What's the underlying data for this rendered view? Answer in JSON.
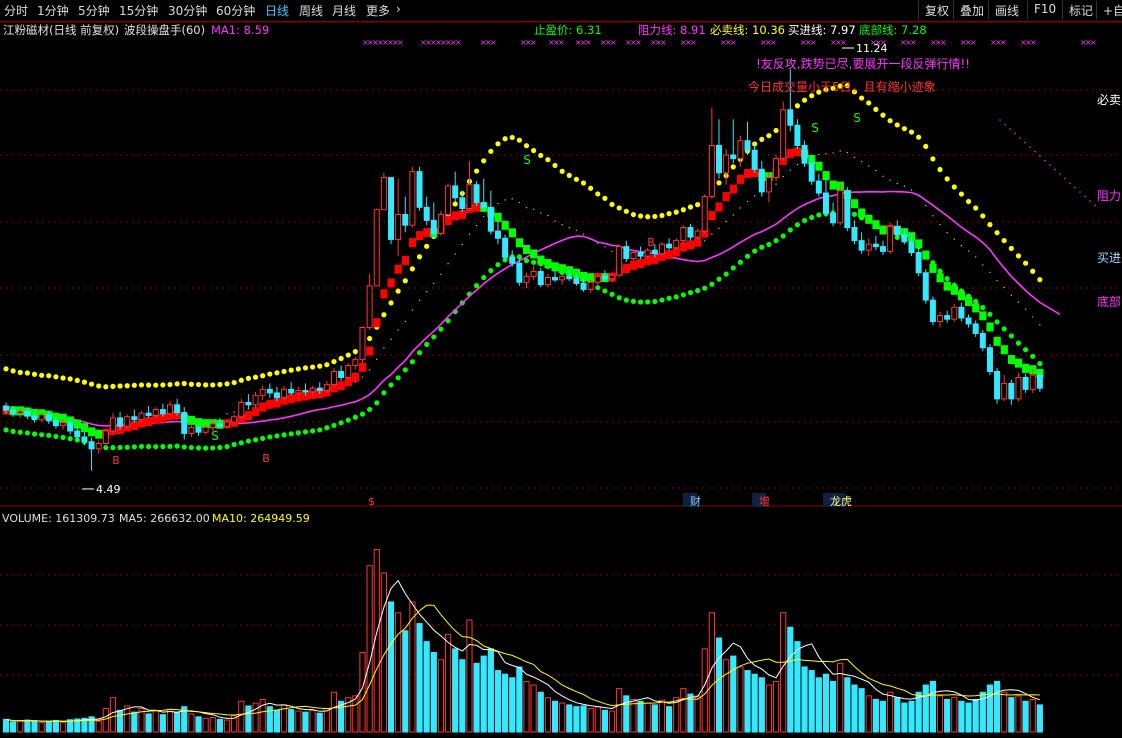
{
  "toolbar": {
    "periods": [
      "分时",
      "1分钟",
      "5分钟",
      "15分钟",
      "30分钟",
      "60分钟",
      "日线",
      "周线",
      "月线",
      "更多"
    ],
    "active_period": "日线",
    "buttons": [
      "复权",
      "叠加",
      "画线",
      "F10",
      "标记",
      "+自选"
    ]
  },
  "main_header": {
    "title": "江粉磁材(日线 前复权)",
    "indicator": "波段操盘手(60)",
    "ma1_label": "MA1: 8.59",
    "stop_profit": "止盈价: 6.31",
    "resist": "阻力线: 8.91",
    "must_sell": "必卖线: 10.36",
    "buy_line": "买进线: 7.97",
    "bottom_line": "底部线: 7.28"
  },
  "annotations": {
    "msg1": "!友反攻,跌势已尽,要展开一段反弹行情!!",
    "msg2": "今日成交量小于5日，且有缩小迹象",
    "high_label": "11.24",
    "low_label": "4.49",
    "right_labels": [
      "必卖",
      "阻力",
      "买进",
      "底部"
    ],
    "event_labels": [
      "$",
      "财",
      "增",
      "龙虎"
    ],
    "buy_mark": "B",
    "sell_mark": "S"
  },
  "volume_header": {
    "volume": "VOLUME: 161309.73",
    "ma5": "MA5: 266632.00",
    "ma10": "MA10: 264949.59"
  },
  "colors": {
    "up": "#ff3333",
    "down": "#33e8ff",
    "red_band": "#ff0000",
    "green_band": "#00ff00",
    "yellow_dots": "#ffff00",
    "ma1": "#ff33ff",
    "ma5": "#ffffff",
    "ma10": "#ffff00",
    "grid": "#8b0000"
  },
  "chart_data": {
    "type": "candlestick",
    "ylim": [
      4.0,
      11.8
    ],
    "volume_ylim": [
      0,
      570000
    ],
    "candles": [
      {
        "o": 5.58,
        "h": 5.64,
        "l": 5.45,
        "c": 5.51,
        "v": 35000
      },
      {
        "o": 5.51,
        "h": 5.58,
        "l": 5.4,
        "c": 5.46,
        "v": 28000
      },
      {
        "o": 5.46,
        "h": 5.54,
        "l": 5.38,
        "c": 5.49,
        "v": 30000
      },
      {
        "o": 5.49,
        "h": 5.55,
        "l": 5.36,
        "c": 5.41,
        "v": 33000
      },
      {
        "o": 5.41,
        "h": 5.48,
        "l": 5.3,
        "c": 5.35,
        "v": 31000
      },
      {
        "o": 5.35,
        "h": 5.46,
        "l": 5.31,
        "c": 5.43,
        "v": 26000
      },
      {
        "o": 5.43,
        "h": 5.5,
        "l": 5.28,
        "c": 5.33,
        "v": 29000
      },
      {
        "o": 5.33,
        "h": 5.4,
        "l": 5.2,
        "c": 5.25,
        "v": 32000
      },
      {
        "o": 5.25,
        "h": 5.36,
        "l": 5.18,
        "c": 5.3,
        "v": 27000
      },
      {
        "o": 5.3,
        "h": 5.36,
        "l": 5.1,
        "c": 5.16,
        "v": 34000
      },
      {
        "o": 5.16,
        "h": 5.24,
        "l": 5.02,
        "c": 5.06,
        "v": 36000
      },
      {
        "o": 5.06,
        "h": 5.14,
        "l": 4.92,
        "c": 4.98,
        "v": 38000
      },
      {
        "o": 4.98,
        "h": 5.05,
        "l": 4.49,
        "c": 4.86,
        "v": 42000
      },
      {
        "o": 4.86,
        "h": 5.0,
        "l": 4.78,
        "c": 4.95,
        "v": 30000
      },
      {
        "o": 4.95,
        "h": 5.2,
        "l": 4.9,
        "c": 5.16,
        "v": 65000
      },
      {
        "o": 5.16,
        "h": 5.46,
        "l": 5.12,
        "c": 5.38,
        "v": 95000
      },
      {
        "o": 5.38,
        "h": 5.48,
        "l": 5.18,
        "c": 5.24,
        "v": 60000
      },
      {
        "o": 5.24,
        "h": 5.44,
        "l": 5.2,
        "c": 5.4,
        "v": 72000
      },
      {
        "o": 5.4,
        "h": 5.52,
        "l": 5.3,
        "c": 5.35,
        "v": 55000
      },
      {
        "o": 5.35,
        "h": 5.5,
        "l": 5.3,
        "c": 5.46,
        "v": 65000
      },
      {
        "o": 5.46,
        "h": 5.58,
        "l": 5.38,
        "c": 5.42,
        "v": 50000
      },
      {
        "o": 5.42,
        "h": 5.56,
        "l": 5.38,
        "c": 5.52,
        "v": 58000
      },
      {
        "o": 5.52,
        "h": 5.62,
        "l": 5.4,
        "c": 5.45,
        "v": 48000
      },
      {
        "o": 5.45,
        "h": 5.66,
        "l": 5.42,
        "c": 5.6,
        "v": 62000
      },
      {
        "o": 5.6,
        "h": 5.7,
        "l": 5.42,
        "c": 5.47,
        "v": 55000
      },
      {
        "o": 5.47,
        "h": 5.56,
        "l": 5.02,
        "c": 5.12,
        "v": 70000
      },
      {
        "o": 5.12,
        "h": 5.28,
        "l": 5.06,
        "c": 5.22,
        "v": 50000
      },
      {
        "o": 5.22,
        "h": 5.3,
        "l": 5.08,
        "c": 5.14,
        "v": 42000
      },
      {
        "o": 5.14,
        "h": 5.26,
        "l": 5.1,
        "c": 5.22,
        "v": 38000
      },
      {
        "o": 5.22,
        "h": 5.34,
        "l": 5.16,
        "c": 5.28,
        "v": 40000
      },
      {
        "o": 5.28,
        "h": 5.38,
        "l": 5.2,
        "c": 5.24,
        "v": 35000
      },
      {
        "o": 5.24,
        "h": 5.34,
        "l": 5.2,
        "c": 5.31,
        "v": 33000
      },
      {
        "o": 5.31,
        "h": 5.44,
        "l": 5.26,
        "c": 5.4,
        "v": 45000
      },
      {
        "o": 5.4,
        "h": 5.7,
        "l": 5.36,
        "c": 5.64,
        "v": 85000
      },
      {
        "o": 5.64,
        "h": 5.78,
        "l": 5.52,
        "c": 5.6,
        "v": 72000
      },
      {
        "o": 5.6,
        "h": 5.82,
        "l": 5.56,
        "c": 5.76,
        "v": 80000
      },
      {
        "o": 5.76,
        "h": 5.92,
        "l": 5.68,
        "c": 5.86,
        "v": 90000
      },
      {
        "o": 5.86,
        "h": 5.96,
        "l": 5.72,
        "c": 5.8,
        "v": 70000
      },
      {
        "o": 5.8,
        "h": 5.9,
        "l": 5.66,
        "c": 5.72,
        "v": 60000
      },
      {
        "o": 5.72,
        "h": 5.92,
        "l": 5.68,
        "c": 5.86,
        "v": 75000
      },
      {
        "o": 5.86,
        "h": 5.98,
        "l": 5.76,
        "c": 5.8,
        "v": 62000
      },
      {
        "o": 5.8,
        "h": 5.9,
        "l": 5.7,
        "c": 5.84,
        "v": 58000
      },
      {
        "o": 5.84,
        "h": 5.96,
        "l": 5.76,
        "c": 5.82,
        "v": 55000
      },
      {
        "o": 5.82,
        "h": 5.92,
        "l": 5.74,
        "c": 5.88,
        "v": 60000
      },
      {
        "o": 5.88,
        "h": 5.98,
        "l": 5.78,
        "c": 5.84,
        "v": 52000
      },
      {
        "o": 5.84,
        "h": 6.0,
        "l": 5.8,
        "c": 5.94,
        "v": 65000
      },
      {
        "o": 5.94,
        "h": 6.22,
        "l": 5.9,
        "c": 6.16,
        "v": 110000
      },
      {
        "o": 6.16,
        "h": 6.26,
        "l": 6.0,
        "c": 6.06,
        "v": 85000
      },
      {
        "o": 6.06,
        "h": 6.3,
        "l": 6.02,
        "c": 6.26,
        "v": 95000
      },
      {
        "o": 6.26,
        "h": 6.4,
        "l": 6.2,
        "c": 6.36,
        "v": 100000
      },
      {
        "o": 6.36,
        "h": 6.92,
        "l": 6.3,
        "c": 6.9,
        "v": 220000
      },
      {
        "o": 6.9,
        "h": 7.8,
        "l": 6.86,
        "c": 7.6,
        "v": 460000
      },
      {
        "o": 7.6,
        "h": 8.9,
        "l": 7.6,
        "c": 8.88,
        "v": 505000
      },
      {
        "o": 8.88,
        "h": 9.5,
        "l": 8.9,
        "c": 9.42,
        "v": 440000
      },
      {
        "o": 9.42,
        "h": 9.42,
        "l": 8.3,
        "c": 8.38,
        "v": 360000
      },
      {
        "o": 8.38,
        "h": 9.4,
        "l": 8.1,
        "c": 8.8,
        "v": 330000
      },
      {
        "o": 8.8,
        "h": 9.1,
        "l": 8.5,
        "c": 8.62,
        "v": 280000
      },
      {
        "o": 8.62,
        "h": 9.6,
        "l": 8.58,
        "c": 9.52,
        "v": 360000
      },
      {
        "o": 9.52,
        "h": 9.6,
        "l": 8.86,
        "c": 8.92,
        "v": 300000
      },
      {
        "o": 8.92,
        "h": 9.1,
        "l": 8.62,
        "c": 8.7,
        "v": 250000
      },
      {
        "o": 8.7,
        "h": 9.0,
        "l": 8.4,
        "c": 8.48,
        "v": 220000
      },
      {
        "o": 8.48,
        "h": 8.86,
        "l": 8.44,
        "c": 8.8,
        "v": 200000
      },
      {
        "o": 8.8,
        "h": 9.32,
        "l": 8.76,
        "c": 9.28,
        "v": 270000
      },
      {
        "o": 9.28,
        "h": 9.52,
        "l": 9.0,
        "c": 9.08,
        "v": 230000
      },
      {
        "o": 9.08,
        "h": 9.2,
        "l": 8.84,
        "c": 8.9,
        "v": 200000
      },
      {
        "o": 8.9,
        "h": 9.7,
        "l": 8.86,
        "c": 9.3,
        "v": 310000
      },
      {
        "o": 9.3,
        "h": 9.36,
        "l": 8.94,
        "c": 9.0,
        "v": 190000
      },
      {
        "o": 9.0,
        "h": 9.4,
        "l": 8.86,
        "c": 8.92,
        "v": 210000
      },
      {
        "o": 8.92,
        "h": 9.2,
        "l": 8.46,
        "c": 8.52,
        "v": 230000
      },
      {
        "o": 8.52,
        "h": 8.7,
        "l": 8.3,
        "c": 8.4,
        "v": 170000
      },
      {
        "o": 8.4,
        "h": 8.46,
        "l": 8.02,
        "c": 8.08,
        "v": 160000
      },
      {
        "o": 8.08,
        "h": 8.2,
        "l": 7.92,
        "c": 7.98,
        "v": 150000
      },
      {
        "o": 7.98,
        "h": 8.06,
        "l": 7.6,
        "c": 7.66,
        "v": 180000
      },
      {
        "o": 7.66,
        "h": 7.82,
        "l": 7.56,
        "c": 7.76,
        "v": 140000
      },
      {
        "o": 7.76,
        "h": 7.94,
        "l": 7.7,
        "c": 7.84,
        "v": 130000
      },
      {
        "o": 7.84,
        "h": 7.9,
        "l": 7.58,
        "c": 7.62,
        "v": 110000
      },
      {
        "o": 7.62,
        "h": 7.8,
        "l": 7.58,
        "c": 7.74,
        "v": 95000
      },
      {
        "o": 7.74,
        "h": 7.84,
        "l": 7.66,
        "c": 7.7,
        "v": 85000
      },
      {
        "o": 7.7,
        "h": 7.8,
        "l": 7.62,
        "c": 7.76,
        "v": 80000
      },
      {
        "o": 7.76,
        "h": 7.86,
        "l": 7.68,
        "c": 7.72,
        "v": 75000
      },
      {
        "o": 7.72,
        "h": 7.8,
        "l": 7.6,
        "c": 7.64,
        "v": 70000
      },
      {
        "o": 7.64,
        "h": 7.74,
        "l": 7.5,
        "c": 7.54,
        "v": 72000
      },
      {
        "o": 7.54,
        "h": 7.7,
        "l": 7.48,
        "c": 7.66,
        "v": 65000
      },
      {
        "o": 7.66,
        "h": 7.8,
        "l": 7.6,
        "c": 7.76,
        "v": 70000
      },
      {
        "o": 7.76,
        "h": 7.86,
        "l": 7.68,
        "c": 7.72,
        "v": 60000
      },
      {
        "o": 7.72,
        "h": 7.82,
        "l": 7.66,
        "c": 7.78,
        "v": 58000
      },
      {
        "o": 7.78,
        "h": 8.3,
        "l": 7.74,
        "c": 8.26,
        "v": 120000
      },
      {
        "o": 8.26,
        "h": 8.36,
        "l": 8.0,
        "c": 8.06,
        "v": 100000
      },
      {
        "o": 8.06,
        "h": 8.2,
        "l": 8.02,
        "c": 8.16,
        "v": 90000
      },
      {
        "o": 8.16,
        "h": 8.26,
        "l": 8.06,
        "c": 8.1,
        "v": 85000
      },
      {
        "o": 8.1,
        "h": 8.24,
        "l": 8.06,
        "c": 8.2,
        "v": 80000
      },
      {
        "o": 8.2,
        "h": 8.3,
        "l": 8.08,
        "c": 8.14,
        "v": 75000
      },
      {
        "o": 8.14,
        "h": 8.34,
        "l": 8.1,
        "c": 8.3,
        "v": 88000
      },
      {
        "o": 8.3,
        "h": 8.4,
        "l": 8.2,
        "c": 8.24,
        "v": 70000
      },
      {
        "o": 8.24,
        "h": 8.4,
        "l": 8.2,
        "c": 8.36,
        "v": 95000
      },
      {
        "o": 8.36,
        "h": 8.62,
        "l": 8.3,
        "c": 8.58,
        "v": 120000
      },
      {
        "o": 8.58,
        "h": 8.64,
        "l": 8.36,
        "c": 8.42,
        "v": 105000
      },
      {
        "o": 8.42,
        "h": 8.56,
        "l": 8.38,
        "c": 8.52,
        "v": 100000
      },
      {
        "o": 8.52,
        "h": 9.14,
        "l": 8.48,
        "c": 9.1,
        "v": 230000
      },
      {
        "o": 9.1,
        "h": 10.6,
        "l": 9.06,
        "c": 9.96,
        "v": 330000
      },
      {
        "o": 9.96,
        "h": 10.4,
        "l": 9.4,
        "c": 9.5,
        "v": 260000
      },
      {
        "o": 9.5,
        "h": 9.9,
        "l": 9.3,
        "c": 9.8,
        "v": 200000
      },
      {
        "o": 9.8,
        "h": 10.4,
        "l": 9.66,
        "c": 9.74,
        "v": 210000
      },
      {
        "o": 9.74,
        "h": 10.12,
        "l": 9.6,
        "c": 10.04,
        "v": 180000
      },
      {
        "o": 10.04,
        "h": 10.36,
        "l": 9.8,
        "c": 9.88,
        "v": 170000
      },
      {
        "o": 9.88,
        "h": 10.0,
        "l": 9.5,
        "c": 9.56,
        "v": 160000
      },
      {
        "o": 9.56,
        "h": 9.7,
        "l": 9.1,
        "c": 9.18,
        "v": 150000
      },
      {
        "o": 9.18,
        "h": 9.5,
        "l": 9.0,
        "c": 9.42,
        "v": 130000
      },
      {
        "o": 9.42,
        "h": 9.8,
        "l": 9.36,
        "c": 9.74,
        "v": 140000
      },
      {
        "o": 9.74,
        "h": 10.7,
        "l": 9.7,
        "c": 10.56,
        "v": 330000
      },
      {
        "o": 10.56,
        "h": 11.24,
        "l": 10.2,
        "c": 10.3,
        "v": 290000
      },
      {
        "o": 10.3,
        "h": 10.4,
        "l": 9.9,
        "c": 9.96,
        "v": 250000
      },
      {
        "o": 9.96,
        "h": 10.04,
        "l": 9.6,
        "c": 9.66,
        "v": 180000
      },
      {
        "o": 9.66,
        "h": 9.78,
        "l": 9.3,
        "c": 9.36,
        "v": 170000
      },
      {
        "o": 9.36,
        "h": 9.48,
        "l": 9.1,
        "c": 9.16,
        "v": 150000
      },
      {
        "o": 9.16,
        "h": 9.4,
        "l": 8.76,
        "c": 8.82,
        "v": 160000
      },
      {
        "o": 8.82,
        "h": 9.0,
        "l": 8.6,
        "c": 8.66,
        "v": 140000
      },
      {
        "o": 8.66,
        "h": 9.3,
        "l": 8.62,
        "c": 9.2,
        "v": 190000
      },
      {
        "o": 9.2,
        "h": 9.26,
        "l": 8.52,
        "c": 8.58,
        "v": 150000
      },
      {
        "o": 8.58,
        "h": 8.7,
        "l": 8.3,
        "c": 8.36,
        "v": 130000
      },
      {
        "o": 8.36,
        "h": 8.5,
        "l": 8.14,
        "c": 8.2,
        "v": 120000
      },
      {
        "o": 8.2,
        "h": 8.4,
        "l": 8.1,
        "c": 8.3,
        "v": 100000
      },
      {
        "o": 8.3,
        "h": 8.44,
        "l": 8.2,
        "c": 8.26,
        "v": 90000
      },
      {
        "o": 8.26,
        "h": 8.36,
        "l": 8.12,
        "c": 8.18,
        "v": 85000
      },
      {
        "o": 8.18,
        "h": 8.66,
        "l": 8.14,
        "c": 8.6,
        "v": 110000
      },
      {
        "o": 8.6,
        "h": 8.7,
        "l": 8.4,
        "c": 8.46,
        "v": 95000
      },
      {
        "o": 8.46,
        "h": 8.56,
        "l": 8.3,
        "c": 8.34,
        "v": 80000
      },
      {
        "o": 8.34,
        "h": 8.46,
        "l": 8.1,
        "c": 8.16,
        "v": 85000
      },
      {
        "o": 8.16,
        "h": 8.24,
        "l": 7.76,
        "c": 7.82,
        "v": 110000
      },
      {
        "o": 7.82,
        "h": 7.88,
        "l": 7.3,
        "c": 7.36,
        "v": 130000
      },
      {
        "o": 7.36,
        "h": 7.42,
        "l": 6.94,
        "c": 7.0,
        "v": 140000
      },
      {
        "o": 7.0,
        "h": 7.16,
        "l": 6.9,
        "c": 7.1,
        "v": 100000
      },
      {
        "o": 7.1,
        "h": 7.18,
        "l": 6.98,
        "c": 7.04,
        "v": 90000
      },
      {
        "o": 7.04,
        "h": 7.3,
        "l": 7.0,
        "c": 7.24,
        "v": 95000
      },
      {
        "o": 7.24,
        "h": 7.32,
        "l": 7.0,
        "c": 7.06,
        "v": 85000
      },
      {
        "o": 7.06,
        "h": 7.12,
        "l": 6.9,
        "c": 6.96,
        "v": 80000
      },
      {
        "o": 6.96,
        "h": 7.02,
        "l": 6.74,
        "c": 6.8,
        "v": 90000
      },
      {
        "o": 6.8,
        "h": 6.86,
        "l": 6.5,
        "c": 6.56,
        "v": 110000
      },
      {
        "o": 6.56,
        "h": 6.62,
        "l": 6.1,
        "c": 6.16,
        "v": 130000
      },
      {
        "o": 6.16,
        "h": 6.22,
        "l": 5.62,
        "c": 5.7,
        "v": 140000
      },
      {
        "o": 5.7,
        "h": 6.1,
        "l": 5.66,
        "c": 5.96,
        "v": 110000
      },
      {
        "o": 5.96,
        "h": 6.02,
        "l": 5.6,
        "c": 5.7,
        "v": 95000
      },
      {
        "o": 5.7,
        "h": 6.14,
        "l": 5.66,
        "c": 6.06,
        "v": 100000
      },
      {
        "o": 6.06,
        "h": 6.12,
        "l": 5.8,
        "c": 5.86,
        "v": 85000
      },
      {
        "o": 5.86,
        "h": 6.2,
        "l": 5.8,
        "c": 6.1,
        "v": 90000
      },
      {
        "o": 6.1,
        "h": 6.14,
        "l": 5.82,
        "c": 5.88,
        "v": 75000
      }
    ]
  }
}
